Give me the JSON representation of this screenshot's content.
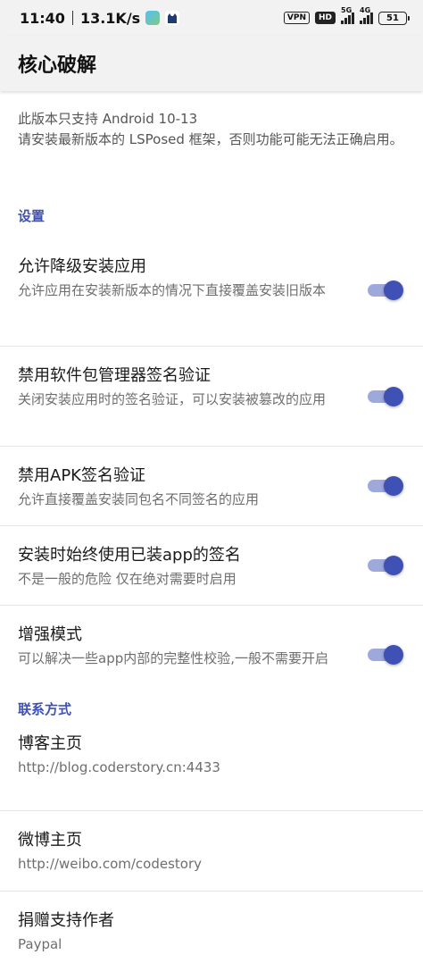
{
  "status_bar": {
    "time": "11:40",
    "net_speed": "13.1K/s",
    "vpn": "VPN",
    "hd": "HD",
    "sig1_label": "5G",
    "sig2_label": "4G",
    "battery": "51"
  },
  "app_bar": {
    "title": "核心破解"
  },
  "notice": {
    "line1": "此版本只支持 Android 10-13",
    "line2": "请安装最新版本的 LSPosed 框架，否则功能可能无法正确启用。"
  },
  "settings": {
    "header": "设置",
    "items": [
      {
        "title": "允许降级安装应用",
        "summary": "允许应用在安装新版本的情况下直接覆盖安装旧版本",
        "enabled": true
      },
      {
        "title": "禁用软件包管理器签名验证",
        "summary": "关闭安装应用时的签名验证，可以安装被篡改的应用",
        "enabled": true
      },
      {
        "title": "禁用APK签名验证",
        "summary": "允许直接覆盖安装同包名不同签名的应用",
        "enabled": true
      },
      {
        "title": "安装时始终使用已装app的签名",
        "summary": "不是一般的危险 仅在绝对需要时启用",
        "enabled": true
      },
      {
        "title": "增强模式",
        "summary": "可以解决一些app内部的完整性校验,一般不需要开启",
        "enabled": true
      }
    ]
  },
  "contact": {
    "header": "联系方式",
    "items": [
      {
        "title": "博客主页",
        "summary": "http://blog.coderstory.cn:4433"
      },
      {
        "title": "微博主页",
        "summary": "http://weibo.com/codestory"
      },
      {
        "title": "捐赠支持作者",
        "summary": "Paypal"
      }
    ]
  },
  "colors": {
    "accent": "#3f51b5",
    "track": "#9fa8da",
    "bar_bg": "#f2f2f2"
  }
}
